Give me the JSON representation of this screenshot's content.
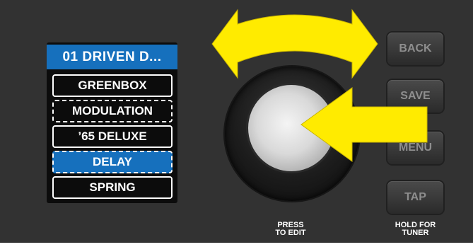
{
  "screen": {
    "title": "01 DRIVEN D...",
    "chain": [
      {
        "label": "GREENBOX",
        "style": "solid",
        "selected": false
      },
      {
        "label": "MODULATION",
        "style": "dashed",
        "selected": false
      },
      {
        "label": "’65 DELUXE",
        "style": "solid",
        "selected": false
      },
      {
        "label": "DELAY",
        "style": "dashed",
        "selected": true
      },
      {
        "label": "SPRING",
        "style": "solid",
        "selected": false
      }
    ]
  },
  "encoder": {
    "caption": "PRESS\nTO EDIT"
  },
  "buttons": {
    "back": "BACK",
    "save": "SAVE",
    "menu": "MENU",
    "tap": "TAP",
    "tap_caption": "HOLD FOR\nTUNER"
  },
  "colors": {
    "panel": "#323232",
    "accent_blue": "#1670bd",
    "indicator_arrow": "#ffeb00"
  }
}
